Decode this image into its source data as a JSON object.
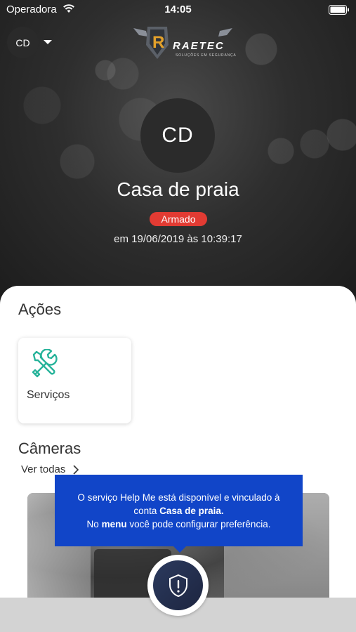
{
  "status_bar": {
    "carrier": "Operadora",
    "time": "14:05"
  },
  "header": {
    "account_initials": "CD",
    "brand_name": "RAETEC",
    "brand_tagline": "SOLUÇÕES EM SEGURANÇA"
  },
  "hero": {
    "avatar_initials": "CD",
    "place_name": "Casa de praia",
    "status": "Armado",
    "status_color": "#e23b33",
    "timestamp": "em 19/06/2019 às 10:39:17"
  },
  "actions": {
    "title": "Ações",
    "items": [
      {
        "label": "Serviços",
        "icon": "tools-icon",
        "icon_color": "#27b39a"
      }
    ]
  },
  "cameras": {
    "title": "Câmeras",
    "see_all": "Ver todas"
  },
  "tooltip": {
    "line1": "O serviço Help Me está disponível e vinculado à",
    "line2_prefix": "conta ",
    "line2_bold": "Casa de praia.",
    "line3_prefix": "No ",
    "line3_bold": "menu",
    "line3_suffix": " você pode configurar preferência.",
    "color": "#1145c8"
  },
  "help_button": {
    "icon": "shield-alert-icon"
  }
}
